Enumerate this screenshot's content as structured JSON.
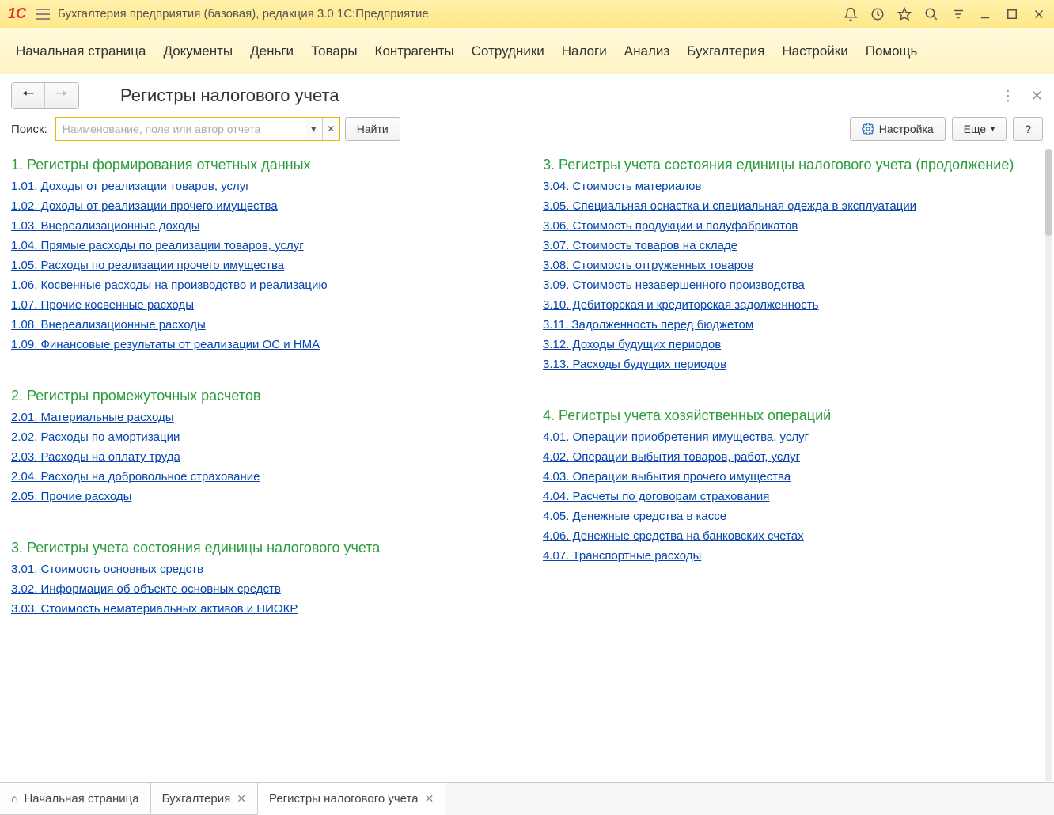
{
  "app": {
    "title": "Бухгалтерия предприятия (базовая), редакция 3.0 1С:Предприятие"
  },
  "menu": [
    "Начальная страница",
    "Документы",
    "Деньги",
    "Товары",
    "Контрагенты",
    "Сотрудники",
    "Налоги",
    "Анализ",
    "Бухгалтерия",
    "Настройки",
    "Помощь"
  ],
  "page": {
    "title": "Регистры налогового учета",
    "search_label": "Поиск:",
    "search_placeholder": "Наименование, поле или автор отчета",
    "find_button": "Найти",
    "settings_button": "Настройка",
    "more_button": "Еще",
    "help_button": "?"
  },
  "sections_left": [
    {
      "title": "1. Регистры формирования отчетных данных",
      "items": [
        "1.01. Доходы от реализации товаров, услуг",
        "1.02. Доходы от реализации прочего имущества",
        "1.03. Внереализационные доходы",
        "1.04. Прямые расходы по реализации товаров, услуг",
        "1.05. Расходы по реализации прочего имущества",
        "1.06. Косвенные расходы на производство и реализацию",
        "1.07. Прочие косвенные расходы",
        "1.08. Внереализационные расходы",
        "1.09. Финансовые результаты от реализации ОС и НМА"
      ]
    },
    {
      "title": "2. Регистры промежуточных расчетов",
      "items": [
        "2.01. Материальные расходы",
        "2.02. Расходы по амортизации",
        "2.03. Расходы на оплату труда",
        "2.04. Расходы на добровольное страхование",
        "2.05. Прочие расходы"
      ]
    },
    {
      "title": "3. Регистры учета состояния единицы налогового учета",
      "items": [
        "3.01. Стоимость основных средств",
        "3.02. Информация об объекте основных средств",
        "3.03. Стоимость нематериальных активов и НИОКР"
      ]
    }
  ],
  "sections_right": [
    {
      "title": "3. Регистры учета состояния единицы налогового учета (продолжение)",
      "items": [
        "3.04. Стоимость материалов",
        "3.05. Специальная оснастка и специальная одежда в эксплуатации",
        "3.06. Стоимость продукции и полуфабрикатов",
        "3.07. Стоимость товаров на складе",
        "3.08. Стоимость отгруженных товаров",
        "3.09. Стоимость незавершенного производства",
        "3.10. Дебиторская и кредиторская задолженность",
        "3.11. Задолженность перед бюджетом",
        "3.12. Доходы будущих периодов",
        "3.13. Расходы будущих периодов"
      ]
    },
    {
      "title": "4. Регистры учета хозяйственных операций",
      "items": [
        "4.01. Операции приобретения имущества, услуг",
        "4.02. Операции выбытия товаров, работ, услуг",
        "4.03. Операции выбытия прочего имущества",
        "4.04. Расчеты по договорам страхования",
        "4.05. Денежные средства в кассе",
        "4.06. Денежные средства на банковских счетах",
        "4.07. Транспортные расходы"
      ]
    }
  ],
  "tabs": [
    {
      "label": "Начальная страница",
      "closable": false,
      "home": true
    },
    {
      "label": "Бухгалтерия",
      "closable": true
    },
    {
      "label": "Регистры налогового учета",
      "closable": true,
      "active": true
    }
  ]
}
